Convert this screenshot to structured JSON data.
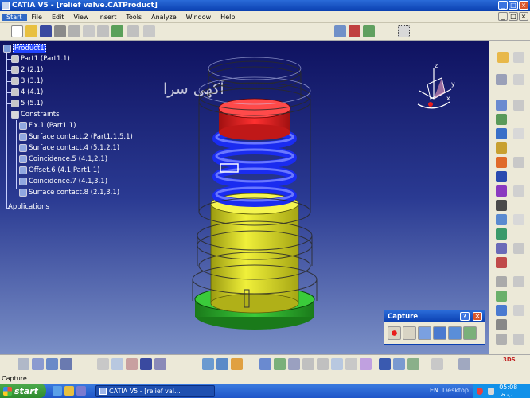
{
  "window": {
    "title": "CATIA V5 - [relief valve.CATProduct]"
  },
  "menu": {
    "items": [
      "Start",
      "File",
      "Edit",
      "View",
      "Insert",
      "Tools",
      "Analyze",
      "Window",
      "Help"
    ]
  },
  "tree": {
    "root": "Product1",
    "parts": [
      "Part1 (Part1.1)",
      "2 (2.1)",
      "3 (3.1)",
      "4 (4.1)",
      "5 (5.1)"
    ],
    "constraints_label": "Constraints",
    "constraints": [
      "Fix.1 (Part1.1)",
      "Surface contact.2 (Part1.1,5.1)",
      "Surface contact.4 (5.1,2.1)",
      "Coincidence.5 (4.1,2.1)",
      "Offset.6 (4.1,Part1.1)",
      "Coincidence.7 (4.1,3.1)",
      "Surface contact.8 (2.1,3.1)"
    ],
    "applications_label": "Applications"
  },
  "watermark": "آکهی سرا",
  "compass": {
    "x": "x",
    "y": "y",
    "z": "z"
  },
  "capture_dialog": {
    "title": "Capture",
    "help": "?",
    "close": "✕"
  },
  "status": {
    "text": "Capture"
  },
  "taskbar": {
    "start": "start",
    "task": "CATIA V5 - [relief val...",
    "lang": "EN",
    "desktop": "Desktop",
    "clock": "05:08 ب.ظ"
  },
  "colors": {
    "title_blue": "#0a3fb0",
    "workspace_top": "#0f1260",
    "workspace_bottom": "#7a8fc6",
    "spring": "#1a2cf0",
    "cap_red": "#e81c1c",
    "core_yellow": "#e8e81a",
    "base_green": "#2aa82a"
  }
}
